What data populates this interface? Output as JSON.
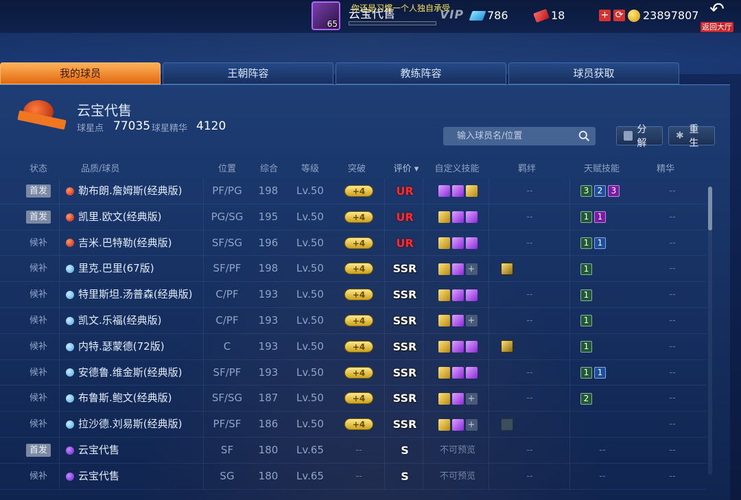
{
  "top_bar": {
    "level": "65",
    "player_name": "云宝代售",
    "marquee": "你还是习惯一个人独自承受",
    "vip_label": "VIP",
    "diamonds": "786",
    "tickets": "18",
    "add_label": "+",
    "coins": "23897807",
    "back_label": "返回大厅",
    "back_arrow": "↶"
  },
  "tabs": [
    "我的球员",
    "王朝阵容",
    "教练阵容",
    "球员获取"
  ],
  "team": {
    "name": "云宝代售",
    "star_points_label": "球星点",
    "star_points": "77035",
    "essence_label": "球星精华",
    "essence": "4120"
  },
  "search": {
    "placeholder": "输入球员名/位置"
  },
  "actions": {
    "decompose": "分解",
    "rebirth": "重生"
  },
  "columns": [
    "状态",
    "品质/球员",
    "位置",
    "综合",
    "等级",
    "突破",
    "评价 ▾",
    "自定义技能",
    "羁绊",
    "天赋技能",
    "精华"
  ],
  "players": [
    {
      "status": "首发",
      "starter": true,
      "quality": "red",
      "name": "勒布朗.詹姆斯(经典版)",
      "position": "PF/PG",
      "overall": "198",
      "level": "Lv.50",
      "breakthrough": "+4",
      "grade": "UR",
      "skills": [
        "purple",
        "purple",
        "gold"
      ],
      "bond": "--",
      "bond_icon": "",
      "talents": [
        {
          "v": "3",
          "c": "green"
        },
        {
          "v": "2",
          "c": "blue"
        },
        {
          "v": "3",
          "c": "purple"
        }
      ],
      "essence": "--"
    },
    {
      "status": "首发",
      "starter": true,
      "quality": "red",
      "name": "凯里.欧文(经典版)",
      "position": "PG/SG",
      "overall": "195",
      "level": "Lv.50",
      "breakthrough": "+4",
      "grade": "UR",
      "skills": [
        "gold",
        "purple",
        "purple"
      ],
      "bond": "--",
      "bond_icon": "",
      "talents": [
        {
          "v": "1",
          "c": "green"
        },
        {
          "v": "1",
          "c": "purple"
        }
      ],
      "essence": "--"
    },
    {
      "status": "候补",
      "starter": false,
      "quality": "red",
      "name": "吉米.巴特勒(经典版)",
      "position": "SF/SG",
      "overall": "196",
      "level": "Lv.50",
      "breakthrough": "+4",
      "grade": "UR",
      "skills": [
        "gold",
        "purple",
        "purple"
      ],
      "bond": "--",
      "bond_icon": "",
      "talents": [
        {
          "v": "1",
          "c": "green"
        },
        {
          "v": "1",
          "c": "blue"
        }
      ],
      "essence": "--"
    },
    {
      "status": "候补",
      "starter": false,
      "quality": "blue",
      "name": "里克.巴里(67版)",
      "position": "SF/PF",
      "overall": "198",
      "level": "Lv.50",
      "breakthrough": "+4",
      "grade": "SSR",
      "skills": [
        "gold",
        "purple",
        "empty"
      ],
      "bond": "",
      "bond_icon": "gold",
      "talents": [
        {
          "v": "1",
          "c": "green"
        }
      ],
      "essence": "--"
    },
    {
      "status": "候补",
      "starter": false,
      "quality": "blue",
      "name": "特里斯坦.汤普森(经典版)",
      "position": "C/PF",
      "overall": "193",
      "level": "Lv.50",
      "breakthrough": "+4",
      "grade": "SSR",
      "skills": [
        "gold",
        "purple",
        "purple"
      ],
      "bond": "--",
      "bond_icon": "",
      "talents": [
        {
          "v": "1",
          "c": "green"
        }
      ],
      "essence": "--"
    },
    {
      "status": "候补",
      "starter": false,
      "quality": "blue",
      "name": "凯文.乐福(经典版)",
      "position": "C/PF",
      "overall": "193",
      "level": "Lv.50",
      "breakthrough": "+4",
      "grade": "SSR",
      "skills": [
        "gold",
        "purple",
        "empty"
      ],
      "bond": "--",
      "bond_icon": "",
      "talents": [
        {
          "v": "1",
          "c": "green"
        }
      ],
      "essence": "--"
    },
    {
      "status": "候补",
      "starter": false,
      "quality": "blue",
      "name": "内特.瑟蒙德(72版)",
      "position": "C",
      "overall": "193",
      "level": "Lv.50",
      "breakthrough": "+4",
      "grade": "SSR",
      "skills": [
        "gold",
        "purple",
        "purple"
      ],
      "bond": "",
      "bond_icon": "gold",
      "talents": [
        {
          "v": "1",
          "c": "green"
        }
      ],
      "essence": "--"
    },
    {
      "status": "候补",
      "starter": false,
      "quality": "blue",
      "name": "安德鲁.维金斯(经典版)",
      "position": "SF/PF",
      "overall": "193",
      "level": "Lv.50",
      "breakthrough": "+4",
      "grade": "SSR",
      "skills": [
        "gold",
        "purple",
        "purple"
      ],
      "bond": "--",
      "bond_icon": "",
      "talents": [
        {
          "v": "1",
          "c": "green"
        },
        {
          "v": "1",
          "c": "blue"
        }
      ],
      "essence": "--"
    },
    {
      "status": "候补",
      "starter": false,
      "quality": "blue",
      "name": "布鲁斯.鲍文(经典版)",
      "position": "SF/SG",
      "overall": "187",
      "level": "Lv.50",
      "breakthrough": "+4",
      "grade": "SSR",
      "skills": [
        "gold",
        "purple",
        "empty"
      ],
      "bond": "--",
      "bond_icon": "",
      "talents": [
        {
          "v": "2",
          "c": "green"
        }
      ],
      "essence": "--"
    },
    {
      "status": "候补",
      "starter": false,
      "quality": "blue",
      "name": "拉沙德.刘易斯(经典版)",
      "position": "PF/SF",
      "overall": "186",
      "level": "Lv.50",
      "breakthrough": "+4",
      "grade": "SSR",
      "skills": [
        "gold",
        "purple",
        "empty"
      ],
      "bond": "",
      "bond_icon": "dim",
      "talents": [],
      "essence": "--"
    },
    {
      "status": "首发",
      "starter": true,
      "quality": "purple",
      "name": "云宝代售",
      "position": "SF",
      "overall": "180",
      "level": "Lv.65",
      "breakthrough": "--",
      "grade": "S",
      "skills_text": "不可预览",
      "skills": [],
      "bond": "--",
      "bond_icon": "",
      "talents_text": "--",
      "talents": [],
      "essence": "--"
    },
    {
      "status": "候补",
      "starter": false,
      "quality": "purple",
      "name": "云宝代售",
      "position": "SG",
      "overall": "180",
      "level": "Lv.65",
      "breakthrough": "--",
      "grade": "S",
      "skills_text": "不可预览",
      "skills": [],
      "bond": "--",
      "bond_icon": "",
      "talents_text": "--",
      "talents": [],
      "essence": "--"
    }
  ]
}
